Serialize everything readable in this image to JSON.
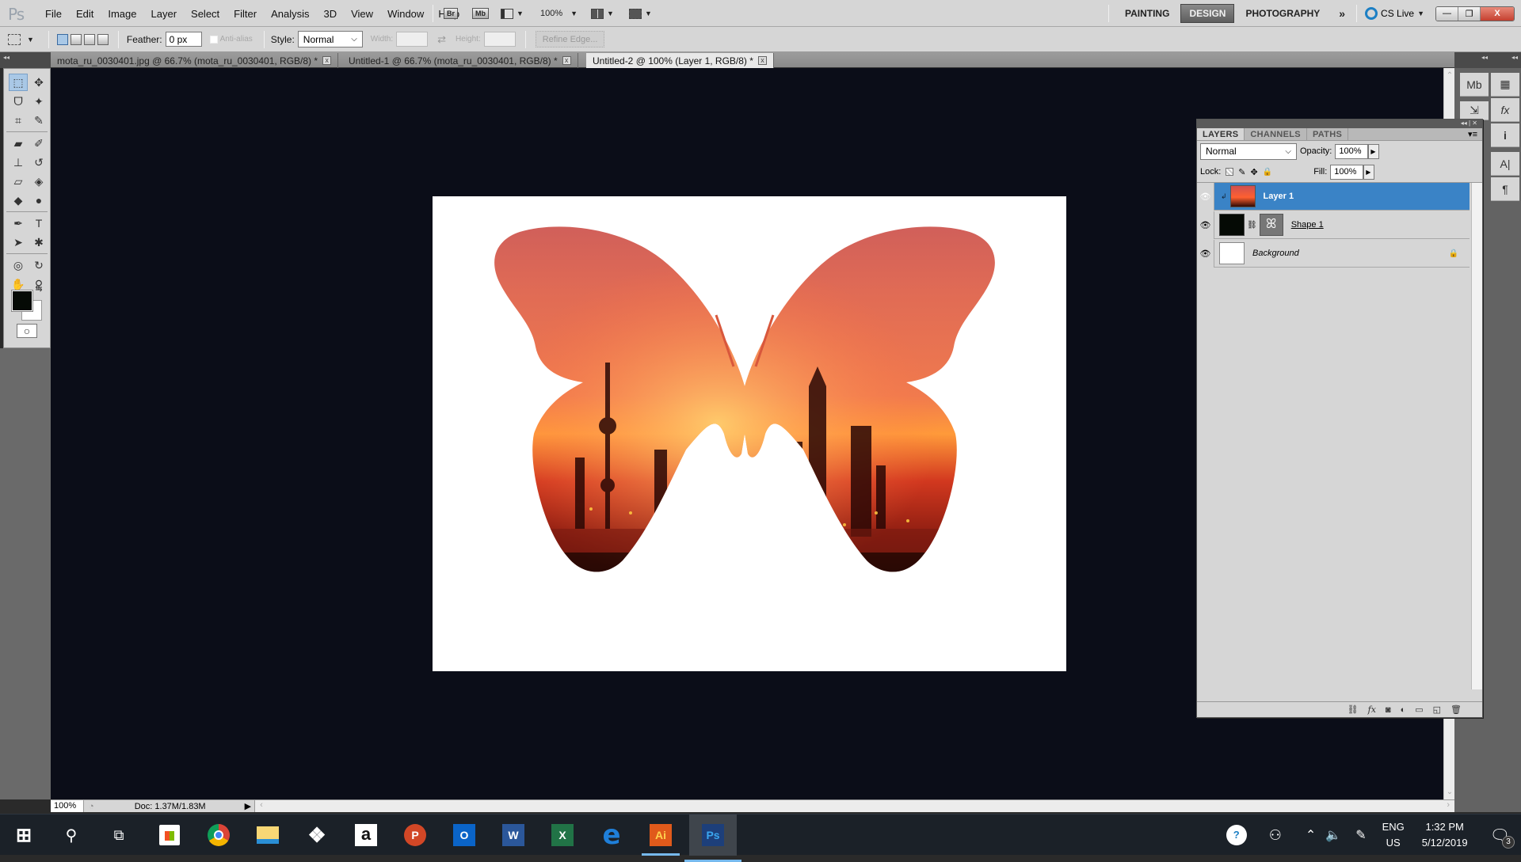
{
  "app": {
    "logo": "Ps"
  },
  "menu": [
    "File",
    "Edit",
    "Image",
    "Layer",
    "Select",
    "Filter",
    "Analysis",
    "3D",
    "View",
    "Window",
    "Help"
  ],
  "menubar_tools": {
    "bridge": "Br",
    "minibridge": "Mb",
    "zoom_level": "100%"
  },
  "workspaces": {
    "items": [
      "PAINTING",
      "DESIGN",
      "PHOTOGRAPHY"
    ],
    "active": "DESIGN",
    "more": "»",
    "cs_live": "CS Live"
  },
  "window_controls": {
    "minimize": "—",
    "restore": "❐",
    "close": "X"
  },
  "options": {
    "feather_label": "Feather:",
    "feather_value": "0 px",
    "antialias_label": "Anti-alias",
    "style_label": "Style:",
    "style_value": "Normal",
    "width_label": "Width:",
    "height_label": "Height:",
    "refine_edge": "Refine Edge..."
  },
  "tabs": [
    {
      "label": "mota_ru_0030401.jpg @ 66.7% (mota_ru_0030401, RGB/8) *",
      "active": false
    },
    {
      "label": "Untitled-1 @ 66.7% (mota_ru_0030401, RGB/8) *",
      "active": false
    },
    {
      "label": "Untitled-2 @ 100% (Layer 1, RGB/8) *",
      "active": true
    }
  ],
  "tab_close": "x",
  "tools": [
    {
      "name": "rectangular-marquee",
      "glyph": "⬚",
      "active": true
    },
    {
      "name": "move",
      "glyph": "✥"
    },
    {
      "name": "lasso",
      "glyph": "ᗜ"
    },
    {
      "name": "magic-wand",
      "glyph": "✦"
    },
    {
      "name": "crop",
      "glyph": "⌗"
    },
    {
      "name": "eyedropper",
      "glyph": "✎"
    },
    {
      "name": "healing-brush",
      "glyph": "▰"
    },
    {
      "name": "brush",
      "glyph": "✐"
    },
    {
      "name": "clone-stamp",
      "glyph": "⊥"
    },
    {
      "name": "history-brush",
      "glyph": "↺"
    },
    {
      "name": "eraser",
      "glyph": "▱"
    },
    {
      "name": "paint-bucket",
      "glyph": "◈"
    },
    {
      "name": "blur",
      "glyph": "◆"
    },
    {
      "name": "dodge",
      "glyph": "●"
    },
    {
      "name": "pen",
      "glyph": "✒"
    },
    {
      "name": "type",
      "glyph": "T"
    },
    {
      "name": "path-selection",
      "glyph": "➤"
    },
    {
      "name": "custom-shape",
      "glyph": "✱"
    },
    {
      "name": "3d-rotate",
      "glyph": "◎"
    },
    {
      "name": "3d-orbit",
      "glyph": "↻"
    },
    {
      "name": "hand",
      "glyph": "✋"
    },
    {
      "name": "zoom",
      "glyph": "⚲"
    }
  ],
  "colors": {
    "foreground": "#050a05",
    "background": "#ffffff",
    "selection_blue": "#3a83c6",
    "doc_bg": "#0b0d18"
  },
  "status": {
    "zoom": "100%",
    "doc": "Doc: 1.37M/1.83M"
  },
  "layers_panel": {
    "tabs": [
      "LAYERS",
      "CHANNELS",
      "PATHS"
    ],
    "active_tab": "LAYERS",
    "blend_mode": "Normal",
    "opacity_label": "Opacity:",
    "opacity": "100%",
    "lock_label": "Lock:",
    "fill_label": "Fill:",
    "fill": "100%",
    "layers": [
      {
        "name": "Layer 1",
        "selected": true,
        "clipped": true
      },
      {
        "name": "Shape 1",
        "selected": false,
        "has_mask": true
      },
      {
        "name": "Background",
        "selected": false,
        "locked": true
      }
    ],
    "footer_icons": [
      "link-icon",
      "fx-icon",
      "mask-icon",
      "adjustment-icon",
      "group-icon",
      "new-layer-icon",
      "trash-icon"
    ]
  },
  "dock": {
    "col1": [
      "Mb",
      "⇲"
    ],
    "col2": [
      "▦",
      "fx",
      "i",
      "A|",
      "¶"
    ]
  },
  "taskbar": {
    "apps": [
      "start",
      "search",
      "task-view",
      "store",
      "chrome",
      "file-explorer",
      "dropbox",
      "amazon",
      "powerpoint",
      "outlook",
      "word",
      "excel",
      "edge",
      "illustrator",
      "photoshop"
    ],
    "labels": {
      "amazon": "a",
      "powerpoint": "P",
      "outlook": "O",
      "word": "W",
      "excel": "X",
      "illustrator": "Ai",
      "photoshop": "Ps"
    },
    "tray": {
      "lang1": "ENG",
      "lang2": "US",
      "time": "1:32 PM",
      "date": "5/12/2019",
      "notifications": "3"
    }
  }
}
